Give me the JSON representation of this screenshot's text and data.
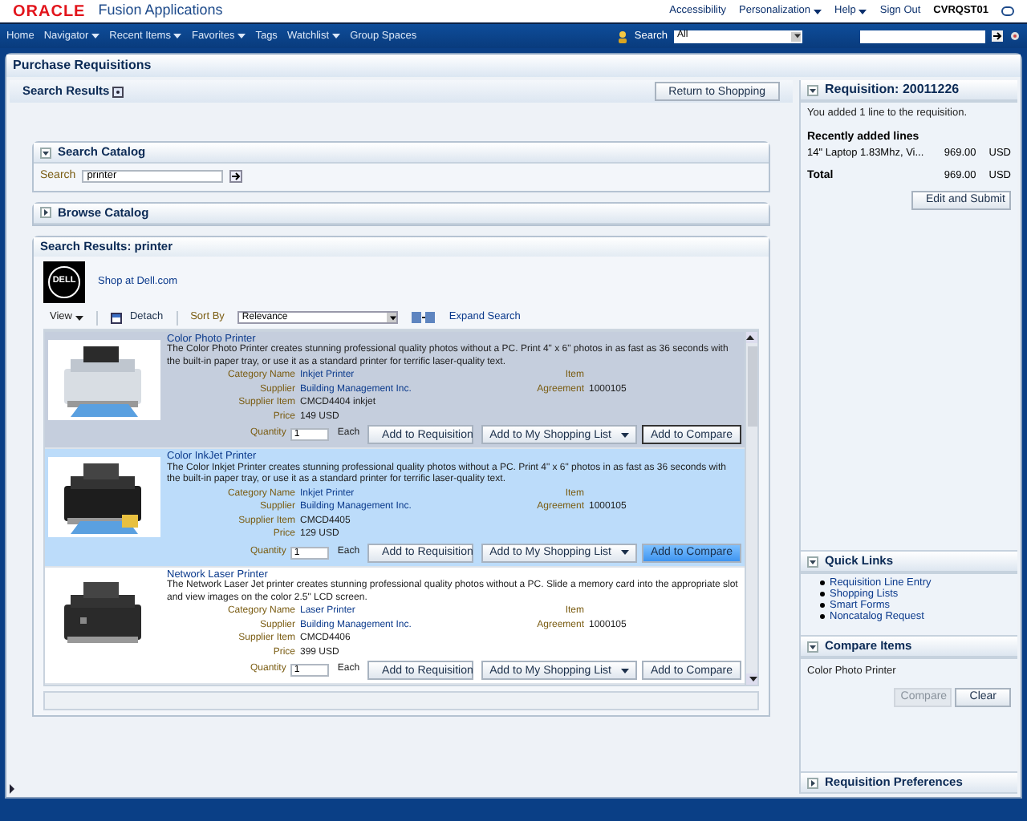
{
  "header": {
    "brand": "ORACLE",
    "product": "Fusion Applications",
    "links": [
      {
        "label": "Accessibility",
        "dropdown": false
      },
      {
        "label": "Personalization",
        "dropdown": true
      },
      {
        "label": "Help",
        "dropdown": true
      },
      {
        "label": "Sign Out",
        "dropdown": false
      }
    ],
    "user": "CVRQST01"
  },
  "nav": {
    "items": [
      {
        "label": "Home",
        "dropdown": false
      },
      {
        "label": "Navigator",
        "dropdown": true
      },
      {
        "label": "Recent Items",
        "dropdown": true
      },
      {
        "label": "Favorites",
        "dropdown": true
      },
      {
        "label": "Tags",
        "dropdown": false
      },
      {
        "label": "Watchlist",
        "dropdown": true
      },
      {
        "label": "Group Spaces",
        "dropdown": false
      }
    ],
    "search_label": "Search",
    "search_scope": "All"
  },
  "page_title": "Purchase Requisitions",
  "search_results": {
    "title": "Search Results",
    "return_button": "Return to Shopping"
  },
  "search_catalog": {
    "title": "Search Catalog",
    "expanded": true,
    "label": "Search",
    "value": "printer"
  },
  "browse_catalog": {
    "title": "Browse Catalog",
    "expanded": false
  },
  "results": {
    "title": "Search Results: printer",
    "logo_text": "DELL",
    "shop_link": "Shop at Dell.com",
    "view": "View",
    "detach": "Detach",
    "sort_label": "Sort By",
    "sort_value": "Relevance",
    "expand_search": "Expand Search",
    "products": [
      {
        "name": "Color Photo Printer",
        "description": "The Color Photo Printer creates stunning professional quality photos without a PC. Print 4\" x 6\" photos in as fast as 36 seconds with the built-in paper tray, or use it as a standard printer for terrific laser-quality text.",
        "selected": true,
        "highlighted": false,
        "details": [
          {
            "label": "Category Name",
            "value": "Inkjet Printer",
            "link": true
          },
          {
            "label": "Supplier",
            "value": "Building Management Inc.",
            "link": true
          },
          {
            "label": "Supplier Item",
            "value": "CMCD4404 inkjet",
            "link": false
          },
          {
            "label": "Price",
            "value": "149 USD",
            "link": false
          }
        ],
        "extra": [
          {
            "label": "Item"
          },
          {
            "label": "Agreement",
            "value": "1000105"
          }
        ],
        "quantity_label": "Quantity",
        "quantity": "1",
        "unit": "Each",
        "add_button": "Add to Requisition",
        "list_button": "Add to My Shopping List",
        "compare_button": "Add to Compare",
        "compare_focused": true
      },
      {
        "name": "Color InkJet Printer",
        "description": "The Color Inkjet Printer creates stunning professional quality photos without a PC. Print 4\" x 6\" photos in as fast as 36 seconds with the built-in paper tray, or use it as a standard printer for terrific laser-quality text.",
        "selected": false,
        "highlighted": true,
        "details": [
          {
            "label": "Category Name",
            "value": "Inkjet Printer",
            "link": true
          },
          {
            "label": "Supplier",
            "value": "Building Management Inc.",
            "link": true
          },
          {
            "label": "Supplier Item",
            "value": "CMCD4405",
            "link": false
          },
          {
            "label": "Price",
            "value": "129 USD",
            "link": false
          }
        ],
        "extra": [
          {
            "label": "Item"
          },
          {
            "label": "Agreement",
            "value": "1000105"
          }
        ],
        "quantity_label": "Quantity",
        "quantity": "1",
        "unit": "Each",
        "add_button": "Add to Requisition",
        "list_button": "Add to My Shopping List",
        "compare_button": "Add to Compare",
        "compare_focused": false
      },
      {
        "name": "Network Laser Printer",
        "description": "The Network Laser Jet printer creates stunning professional quality photos without a PC. Slide a memory card into the appropriate slot and view images on the color 2.5\" LCD screen.",
        "selected": false,
        "highlighted": false,
        "details": [
          {
            "label": "Category Name",
            "value": "Laser Printer",
            "link": true
          },
          {
            "label": "Supplier",
            "value": "Building Management Inc.",
            "link": true
          },
          {
            "label": "Supplier Item",
            "value": "CMCD4406",
            "link": false
          },
          {
            "label": "Price",
            "value": "399 USD",
            "link": false
          }
        ],
        "extra": [
          {
            "label": "Item"
          },
          {
            "label": "Agreement",
            "value": "1000105"
          }
        ],
        "quantity_label": "Quantity",
        "quantity": "1",
        "unit": "Each",
        "add_button": "Add to Requisition",
        "list_button": "Add to My Shopping List",
        "compare_button": "Add to Compare",
        "compare_focused": false
      }
    ]
  },
  "requisition": {
    "title": "Requisition: 20011226",
    "expanded": true,
    "message": "You added 1 line to the requisition.",
    "recent_title": "Recently added lines",
    "lines": [
      {
        "description": "14\" Laptop 1.83Mhz, Vi...",
        "amount": "969.00",
        "currency": "USD"
      }
    ],
    "total_label": "Total",
    "total_amount": "969.00",
    "total_currency": "USD",
    "submit_button": "Edit and Submit"
  },
  "quick_links": {
    "title": "Quick Links",
    "expanded": true,
    "items": [
      "Requisition Line Entry",
      "Shopping Lists",
      "Smart Forms",
      "Noncatalog Request"
    ]
  },
  "compare_items": {
    "title": "Compare Items",
    "expanded": true,
    "items": [
      "Color Photo Printer"
    ],
    "compare_button": {
      "label": "Compare",
      "disabled": true
    },
    "clear_button": {
      "label": "Clear",
      "disabled": false
    }
  },
  "preferences": {
    "title": "Requisition Preferences",
    "expanded": false
  }
}
